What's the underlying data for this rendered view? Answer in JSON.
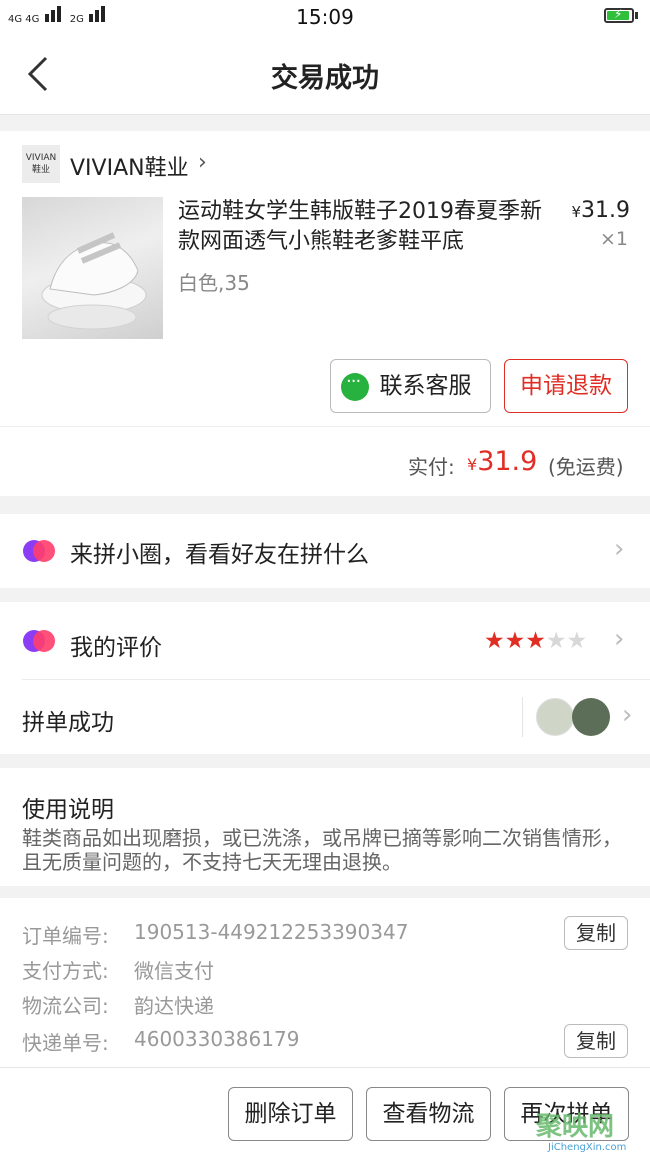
{
  "status_bar": {
    "network_left": "4G 4G",
    "network_right": "2G",
    "time": "15:09"
  },
  "header": {
    "title": "交易成功"
  },
  "shop": {
    "logo_text_1": "VIVIAN",
    "logo_text_2": "鞋业",
    "name": "VIVIAN鞋业",
    "arrow": "›"
  },
  "product": {
    "title": "运动鞋女学生韩版鞋子2019春夏季新款网面透气小熊鞋老爹鞋平底",
    "sku": "白色,35",
    "price_symbol": "¥",
    "price": "31.9",
    "qty": "×1"
  },
  "actions": {
    "contact_label": "联系客服",
    "refund_label": "申请退款"
  },
  "payment": {
    "label": "实付:",
    "symbol": "¥",
    "amount": "31.9",
    "note": "(免运费)"
  },
  "circle": {
    "label": "来拼小圈，看看好友在拼什么"
  },
  "review": {
    "label": "我的评价",
    "rating": 3,
    "max_rating": 5
  },
  "group": {
    "label": "拼单成功"
  },
  "usage": {
    "title": "使用说明",
    "body": "鞋类商品如出现磨损，或已洗涤，或吊牌已摘等影响二次销售情形，且无质量问题的，不支持七天无理由退换。"
  },
  "order_info": {
    "order_no_label": "订单编号:",
    "order_no": "190513-449212253390347",
    "pay_label": "支付方式:",
    "pay_value": "微信支付",
    "logistics_label": "物流公司:",
    "logistics_value": "韵达快递",
    "tracking_label": "快递单号:",
    "tracking_value": "4600330386179",
    "copy_label": "复制"
  },
  "bottom": {
    "delete_label": "删除订单",
    "logistics_label": "查看物流",
    "again_label": "再次拼单"
  },
  "watermark": {
    "text": "聚映网",
    "url": "JiChengXin.com"
  },
  "colors": {
    "accent": "#e02e24",
    "wechat": "#27b13f"
  }
}
